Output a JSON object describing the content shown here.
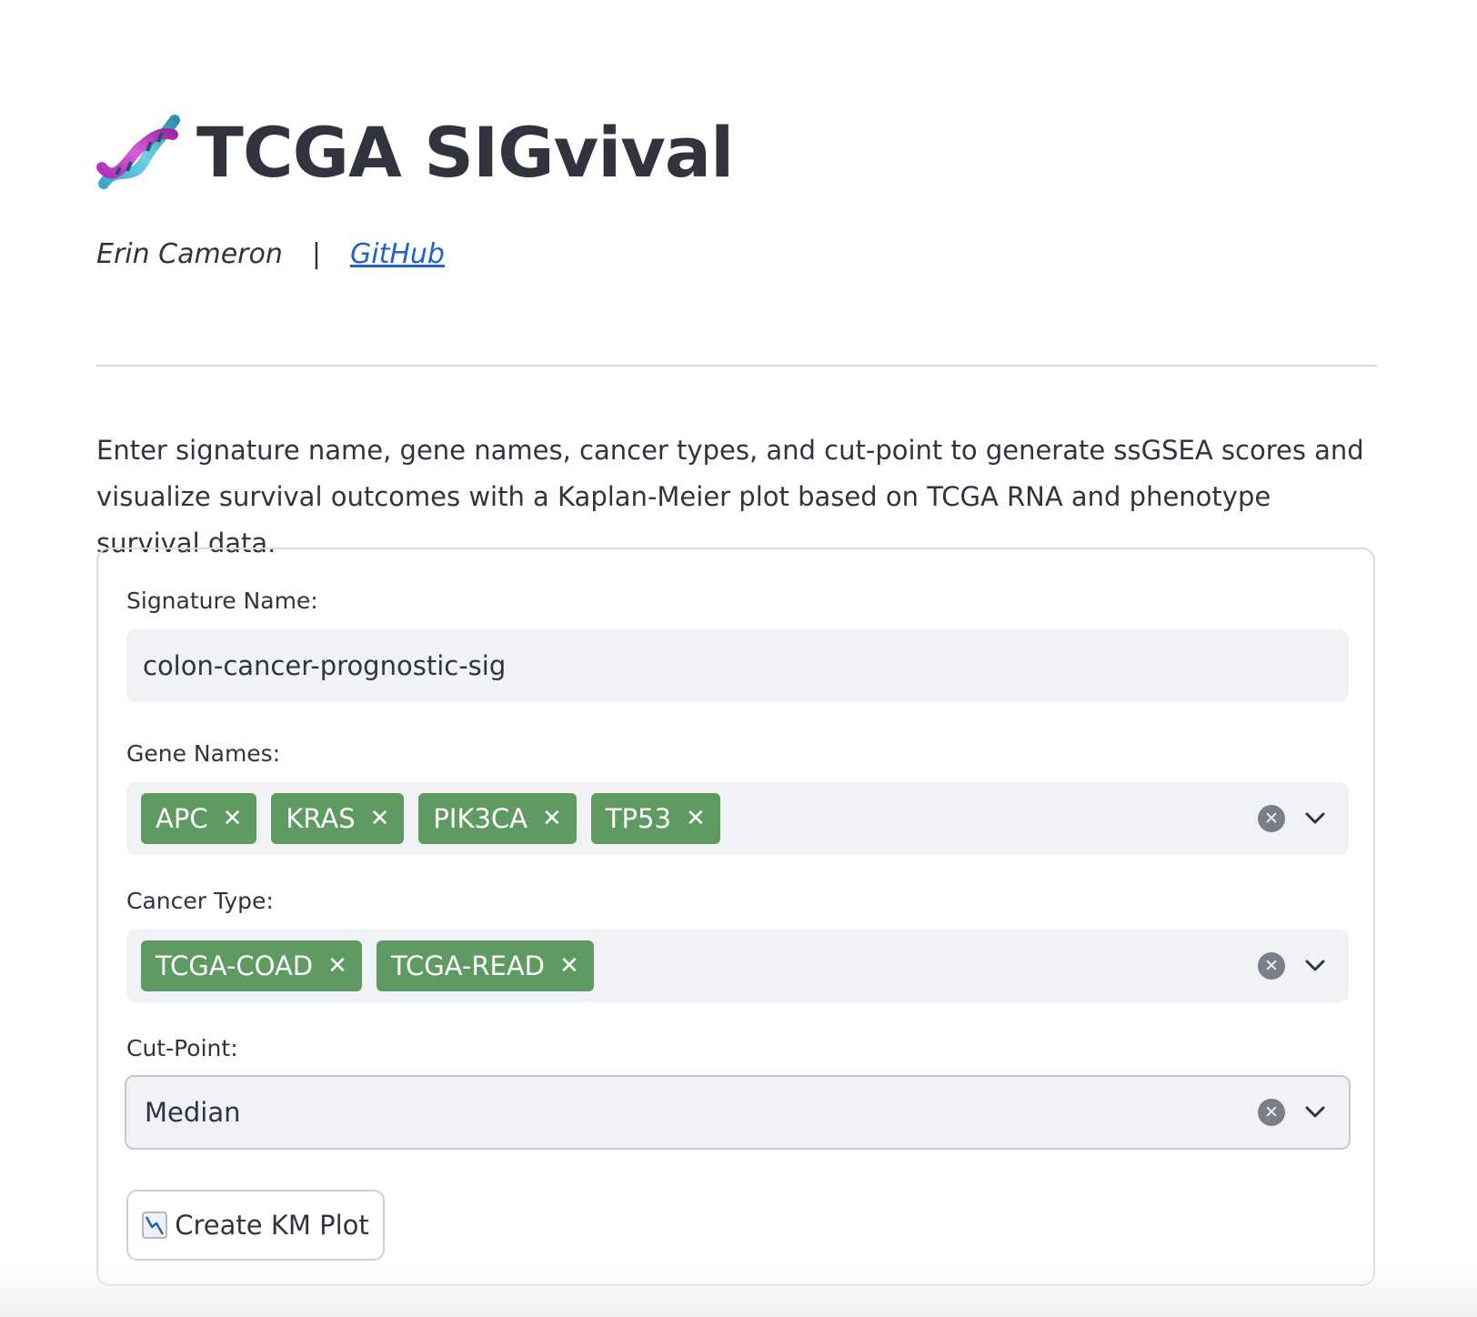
{
  "header": {
    "title": "TCGA SIGvival",
    "icon": "dna-icon",
    "author": "Erin Cameron",
    "separator": "|",
    "github_link": "GitHub"
  },
  "description": "Enter signature name, gene names, cancer types, and cut-point to generate ssGSEA scores and visualize survival outcomes with a Kaplan-Meier plot based on TCGA RNA and phenotype survival data.",
  "form": {
    "signature_name": {
      "label": "Signature Name:",
      "value": "colon-cancer-prognostic-sig"
    },
    "gene_names": {
      "label": "Gene Names:",
      "selected": [
        "APC",
        "KRAS",
        "PIK3CA",
        "TP53"
      ]
    },
    "cancer_type": {
      "label": "Cancer Type:",
      "selected": [
        "TCGA-COAD",
        "TCGA-READ"
      ]
    },
    "cut_point": {
      "label": "Cut-Point:",
      "value": "Median"
    },
    "submit_button": {
      "label": "Create KM Plot",
      "icon": "chart-decreasing-icon"
    }
  },
  "colors": {
    "tag_bg": "#5f9a63",
    "link": "#1f62c9",
    "input_bg": "#f0f2f6",
    "text": "#31333f"
  }
}
